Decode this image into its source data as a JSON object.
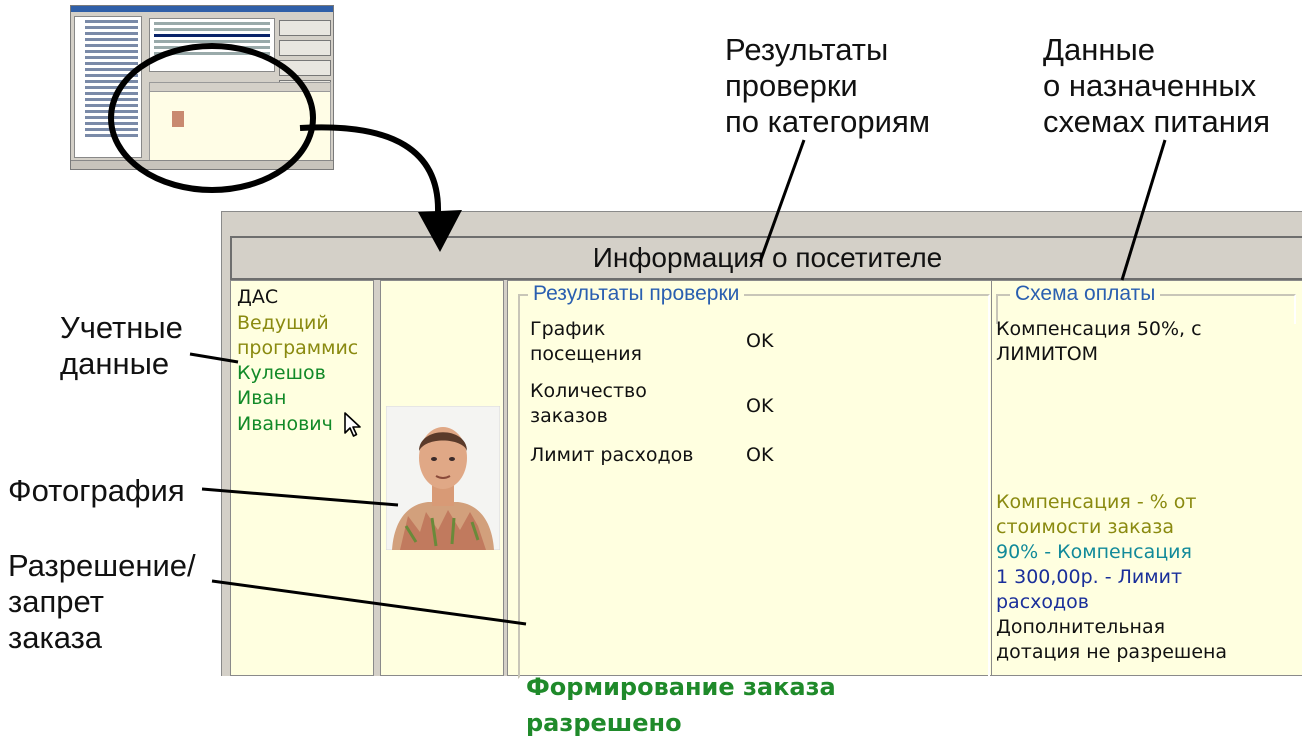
{
  "callouts": {
    "results": "Результаты\nпроверки\nпо категориям",
    "schemes": "Данные\nо назначенных\nсхемах питания",
    "credentials": "Учетные\nданные",
    "photo": "Фотография",
    "permission": "Разрешение/\nзапрет\nзаказа"
  },
  "panel": {
    "title": "Информация о посетителе",
    "user": {
      "login": "ДАС",
      "position_line1": "Ведущий",
      "position_line2": "программис",
      "last_name": "Кулешов",
      "first_name": "Иван",
      "patronymic": "Иванович"
    },
    "checks": {
      "legend": "Результаты проверки",
      "rows": [
        {
          "label_line1": "График",
          "label_line2": "посещения",
          "status": "OK"
        },
        {
          "label_line1": "Количество",
          "label_line2": "заказов",
          "status": "OK"
        },
        {
          "label_line1": "Лимит расходов",
          "label_line2": "",
          "status": "OK"
        }
      ],
      "verdict_line1": "Формирование заказа",
      "verdict_line2": "разрешено"
    },
    "scheme": {
      "legend": "Схема оплаты",
      "name_line1": "Компенсация 50%, с",
      "name_line2": "лимитом",
      "type_line1": "Компенсация - % от",
      "type_line2": "стоимости заказа",
      "compensation": "90% - Компенсация",
      "limit_line1": "1 300,00р. - Лимит",
      "limit_line2": "расходов",
      "extra_line1": "Дополнительная",
      "extra_line2": "дотация не разрешена"
    }
  },
  "icons": [
    "mouse-pointer-icon",
    "callout-arrow-icon"
  ],
  "colors": {
    "panel_bg": "#ffffe0",
    "frame": "#d4d0c8",
    "legend": "#2a5fb0",
    "position": "#8a8a10",
    "name": "#128a28",
    "verdict": "#1f8a2a",
    "compensation": "#128a9a",
    "limit": "#1a2f9a"
  }
}
